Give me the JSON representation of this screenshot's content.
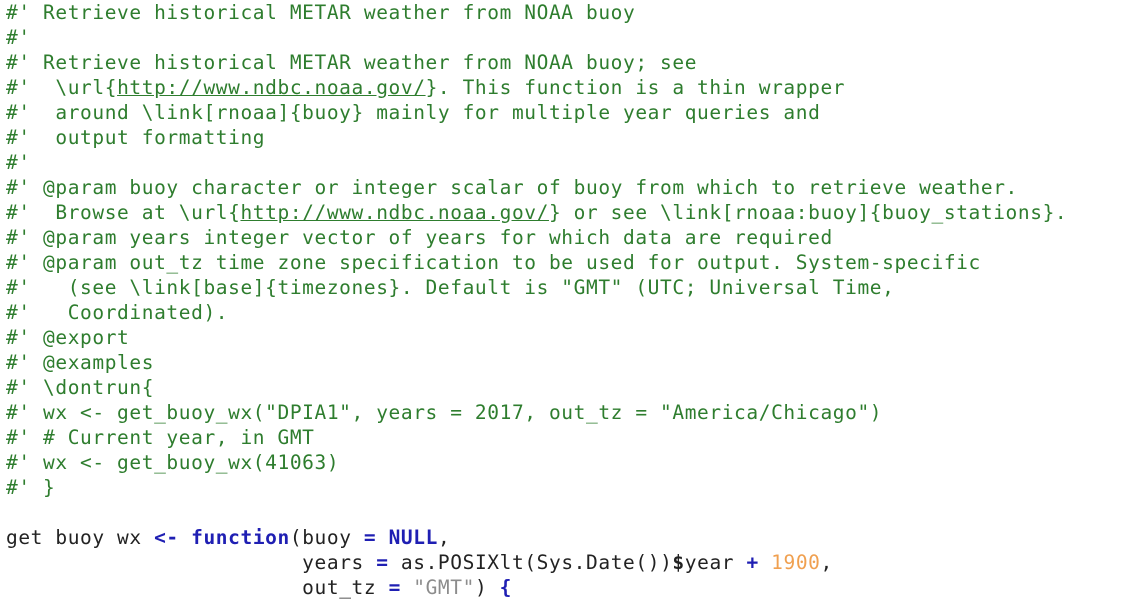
{
  "doc_lines": [
    "#' Retrieve historical METAR weather from NOAA buoy",
    "#'",
    "#' Retrieve historical METAR weather from NOAA buoy; see",
    "#'  \\url{",
    "http://www.ndbc.noaa.gov/",
    "}. This function is a thin wrapper",
    "#'  around \\link[rnoaa]{buoy} mainly for multiple year queries and",
    "#'  output formatting",
    "#'",
    "#' @param buoy character or integer scalar of buoy from which to retrieve weather.",
    "#'  Browse at \\url{",
    "} or see \\link[rnoaa:buoy]{buoy_stations}.",
    "#' @param years integer vector of years for which data are required",
    "#' @param out_tz time zone specification to be used for output. System-specific",
    "#'   (see \\link[base]{timezones}. Default is \"GMT\" (UTC; Universal Time,",
    "#'   Coordinated).",
    "#' @export",
    "#' @examples",
    "#' \\dontrun{",
    "#' wx <- get_buoy_wx(\"DPIA1\", years = 2017, out_tz = \"America/Chicago\")",
    "#' # Current year, in GMT",
    "#' wx <- get_buoy_wx(41063)",
    "#' }"
  ],
  "code": {
    "fn_name": "get buoy wx ",
    "assign": "<-",
    "space": " ",
    "keyword_function": "function",
    "open_paren": "(",
    "arg1": "buoy ",
    "eq": "=",
    "null_kw": "NULL",
    "comma": ",",
    "indent": "                        ",
    "arg2": "years ",
    "as_posix": " as.POSIXlt",
    "sys_date": "Sys.Date",
    "empty_parens": "()",
    "close_paren": ")",
    "dollar": "$",
    "year": "year ",
    "plus": "+",
    "num_1900": "1900",
    "arg3": "out_tz ",
    "gmt_str": "\"GMT\"",
    "brace": "{"
  }
}
